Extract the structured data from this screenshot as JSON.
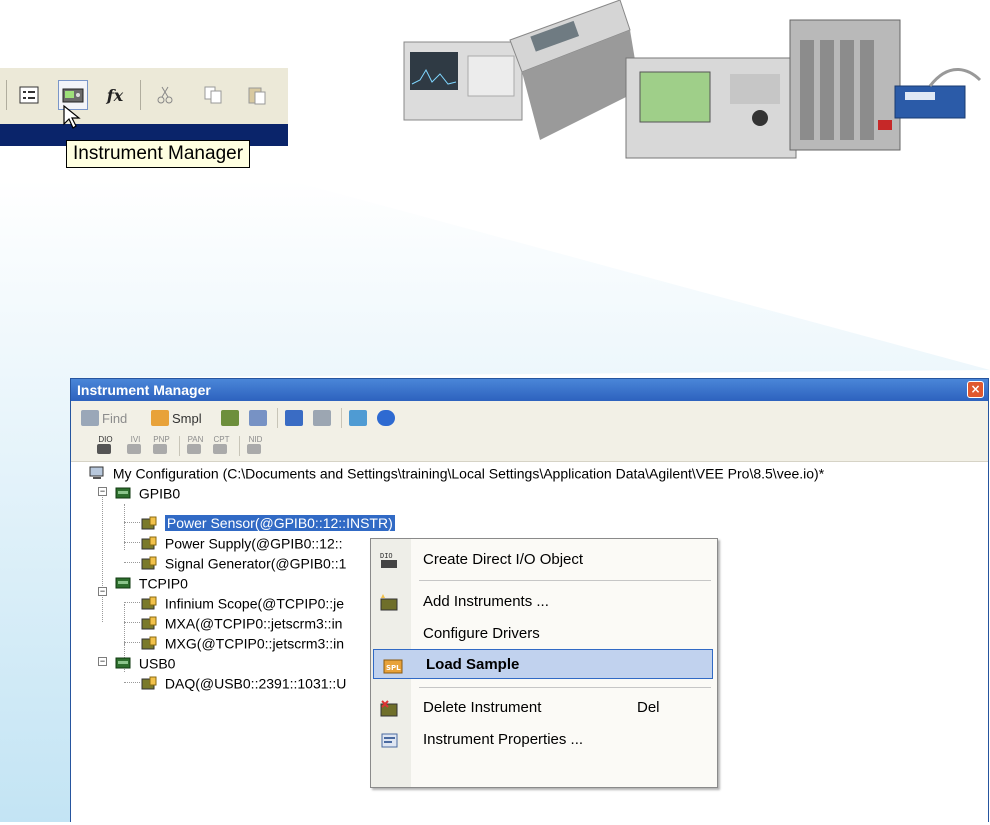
{
  "tooltip": {
    "text": "Instrument Manager"
  },
  "top_toolbar": {
    "fx_label": "fx"
  },
  "window": {
    "title": "Instrument Manager",
    "close_label": "×",
    "toolbar": {
      "find_label": "Find",
      "smpl_label": "Smpl",
      "dio_label": "DIO",
      "ivi_label": "IVI",
      "pnp_label": "PNP",
      "pan_label": "PAN",
      "cpt_label": "CPT",
      "nid_label": "NID"
    },
    "tree": {
      "root": "My Configuration (C:\\Documents and Settings\\training\\Local Settings\\Application Data\\Agilent\\VEE Pro\\8.5\\vee.io)*",
      "groups": [
        {
          "name": "GPIB0",
          "items": [
            "Power Sensor(@GPIB0::12::INSTR)",
            "Power Supply(@GPIB0::12::",
            "Signal Generator(@GPIB0::1"
          ]
        },
        {
          "name": "TCPIP0",
          "items": [
            "Infinium Scope(@TCPIP0::je",
            "MXA(@TCPIP0::jetscrm3::in",
            "MXG(@TCPIP0::jetscrm3::in"
          ]
        },
        {
          "name": "USB0",
          "items": [
            "DAQ(@USB0::2391::1031::U"
          ]
        }
      ]
    }
  },
  "context_menu": {
    "items": [
      {
        "label": "Create Direct I/O Object",
        "icon": "dio-icon"
      },
      {
        "label": "Add Instruments ...",
        "icon": "add-instrument-icon"
      },
      {
        "label": "Configure Drivers",
        "icon": ""
      },
      {
        "label": "Load Sample",
        "icon": "sample-icon",
        "highlighted": true
      },
      {
        "label": "Delete Instrument",
        "shortcut": "Del",
        "icon": "delete-instrument-icon"
      },
      {
        "label": "Instrument Properties ...",
        "icon": "properties-icon"
      }
    ]
  },
  "colors": {
    "title_bar": "#2d62be",
    "selection": "#316ac5",
    "menu_highlight": "#c1d2ee",
    "beam": "#c9e6f5"
  }
}
